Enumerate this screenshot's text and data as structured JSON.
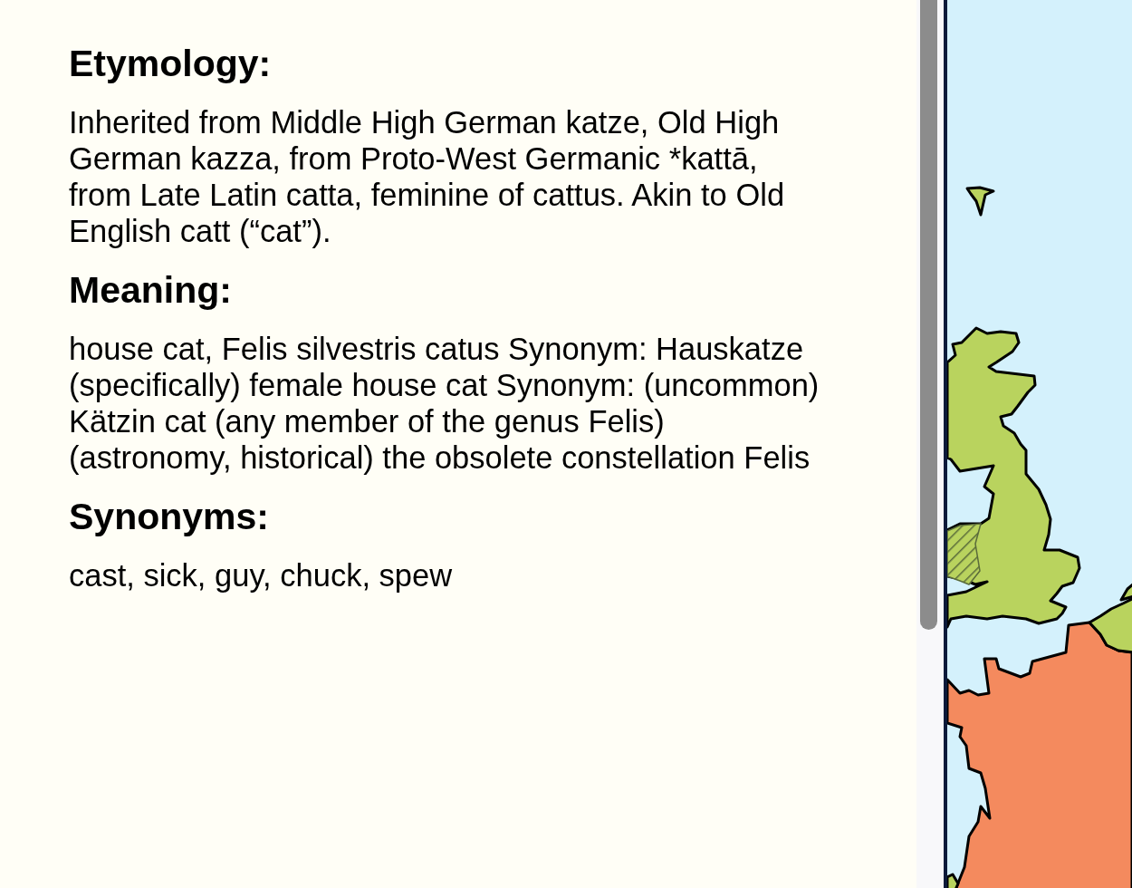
{
  "sections": [
    {
      "heading": "Etymology:",
      "text": "Inherited from Middle High German katze, Old High German kazza, from Proto-West Germanic *kattā, from Late Latin catta, feminine of cattus. Akin to Old English catt (“cat”)."
    },
    {
      "heading": "Meaning:",
      "text": "house cat, Felis silvestris catus Synonym: Hauskatze (specifically) female house cat Synonym: (uncommon) Kätzin cat (any member of the genus Felis) (astronomy, historical) the obsolete constellation Felis"
    },
    {
      "heading": "Synonyms:",
      "text": "cast, sick, guy, chuck, spew"
    }
  ]
}
